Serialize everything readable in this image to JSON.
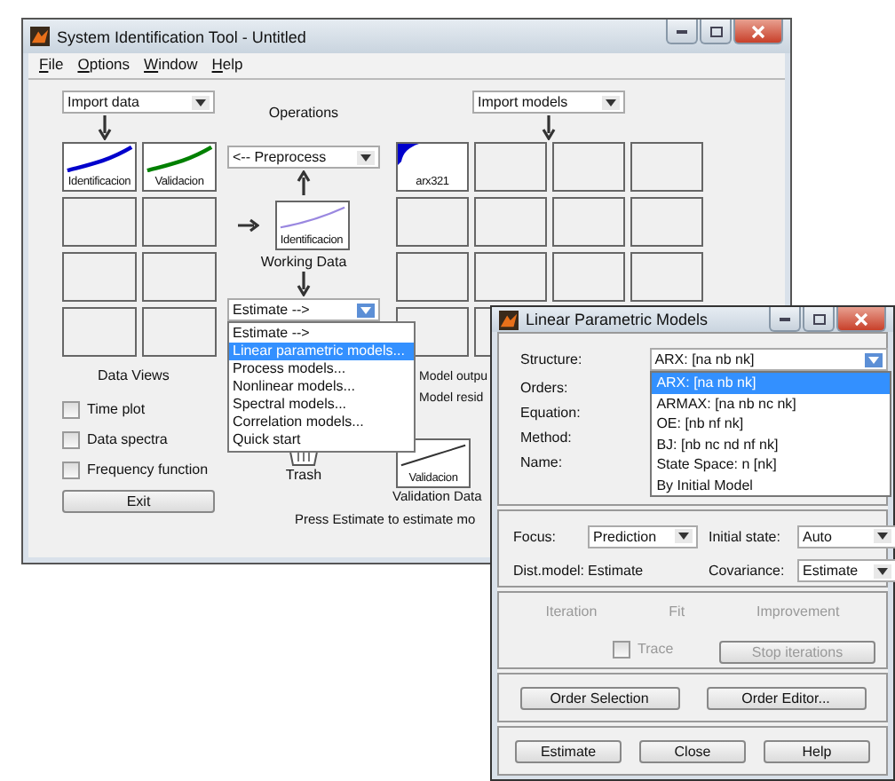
{
  "main_window": {
    "title": "System Identification Tool - Untitled",
    "menu": [
      "File",
      "Options",
      "Window",
      "Help"
    ],
    "import_data": "Import data",
    "operations_label": "Operations",
    "data_boards": [
      {
        "label": "Identificacion",
        "color": "#0000cc"
      },
      {
        "label": "Validacion",
        "color": "#008000"
      }
    ],
    "preprocess": "<-- Preprocess",
    "working_data": {
      "label": "Identificacion",
      "caption": "Working Data"
    },
    "estimate": "Estimate -->",
    "estimate_menu": [
      {
        "label": "Estimate -->",
        "selected": false
      },
      {
        "label": "Linear parametric models...",
        "selected": true
      },
      {
        "label": "Process models...",
        "selected": false
      },
      {
        "label": "Nonlinear models...",
        "selected": false
      },
      {
        "label": "Spectral models...",
        "selected": false
      },
      {
        "label": "Correlation models...",
        "selected": false
      },
      {
        "label": "Quick start",
        "selected": false
      }
    ],
    "data_views_label": "Data Views",
    "data_view_checks": [
      {
        "label": "Time plot",
        "checked": false
      },
      {
        "label": "Data spectra",
        "checked": false
      },
      {
        "label": "Frequency function",
        "checked": false
      }
    ],
    "exit": "Exit",
    "trash": "Trash",
    "import_models": "Import models",
    "model_boards": [
      {
        "label": "arx321"
      }
    ],
    "model_view_labels": [
      "Model outpu",
      "Model resid"
    ],
    "validation_data": {
      "label": "Validacion",
      "caption": "Validation Data"
    },
    "hint": "Press Estimate to estimate mo"
  },
  "lpm_window": {
    "title": "Linear Parametric Models",
    "structure_label": "Structure:",
    "structure_value": "ARX: [na nb nk]",
    "structure_options": [
      {
        "label": "ARX: [na nb nk]",
        "selected": true
      },
      {
        "label": "ARMAX: [na nb nc nk]",
        "selected": false
      },
      {
        "label": "OE: [nb nf nk]",
        "selected": false
      },
      {
        "label": "BJ: [nb nc nd nf nk]",
        "selected": false
      },
      {
        "label": "State Space: n [nk]",
        "selected": false
      },
      {
        "label": "By Initial Model",
        "selected": false
      }
    ],
    "field_labels": [
      "Orders:",
      "Equation:",
      "Method:",
      "Name:"
    ],
    "focus_label": "Focus:",
    "focus": "Prediction",
    "initial_state_label": "Initial state:",
    "initial_state": "Auto",
    "dist_model_label": "Dist.model:",
    "dist_model": "Estimate",
    "covariance_label": "Covariance:",
    "covariance": "Estimate",
    "progress": {
      "disabled": true,
      "headers": [
        "Iteration",
        "Fit",
        "Improvement"
      ],
      "trace": {
        "label": "Trace",
        "checked": false
      },
      "stop_button": "Stop iterations"
    },
    "order_buttons": [
      "Order Selection",
      "Order Editor..."
    ],
    "action_buttons": [
      "Estimate",
      "Close",
      "Help"
    ]
  }
}
